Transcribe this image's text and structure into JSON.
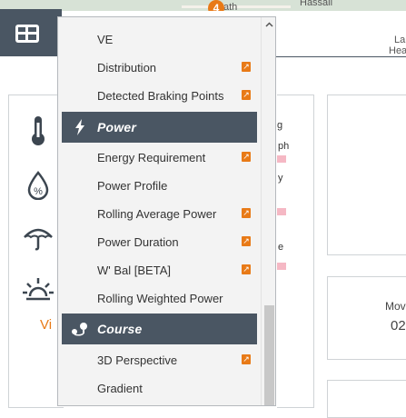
{
  "map": {
    "label_top": "ath",
    "label_right": "Hassall",
    "pin_number": "4",
    "right_label_1": "La",
    "right_label_2": "Hea"
  },
  "background": {
    "vi_text": "Vi",
    "ph_text": "ph",
    "y_text": "y",
    "e_text": "e",
    "g_text": "g",
    "mov_text": "Mov",
    "num_text": "02"
  },
  "dropdown": {
    "items": [
      {
        "label": "VE",
        "external": false
      },
      {
        "label": "Distribution",
        "external": true
      },
      {
        "label": "Detected Braking Points",
        "external": true
      }
    ],
    "power_header": "Power",
    "power_items": [
      {
        "label": "Energy Requirement",
        "external": true
      },
      {
        "label": "Power Profile",
        "external": false
      },
      {
        "label": "Rolling Average Power",
        "external": true
      },
      {
        "label": "Power Duration",
        "external": true
      },
      {
        "label": "W' Bal [BETA]",
        "external": true
      },
      {
        "label": "Rolling Weighted Power",
        "external": false
      }
    ],
    "course_header": "Course",
    "course_items": [
      {
        "label": "3D Perspective",
        "external": true
      },
      {
        "label": "Gradient",
        "external": false
      }
    ],
    "external_glyph": "↗",
    "colors": {
      "header_bg": "#4a5663",
      "accent": "#e87a17",
      "list_bg": "#f3f3f3"
    }
  }
}
